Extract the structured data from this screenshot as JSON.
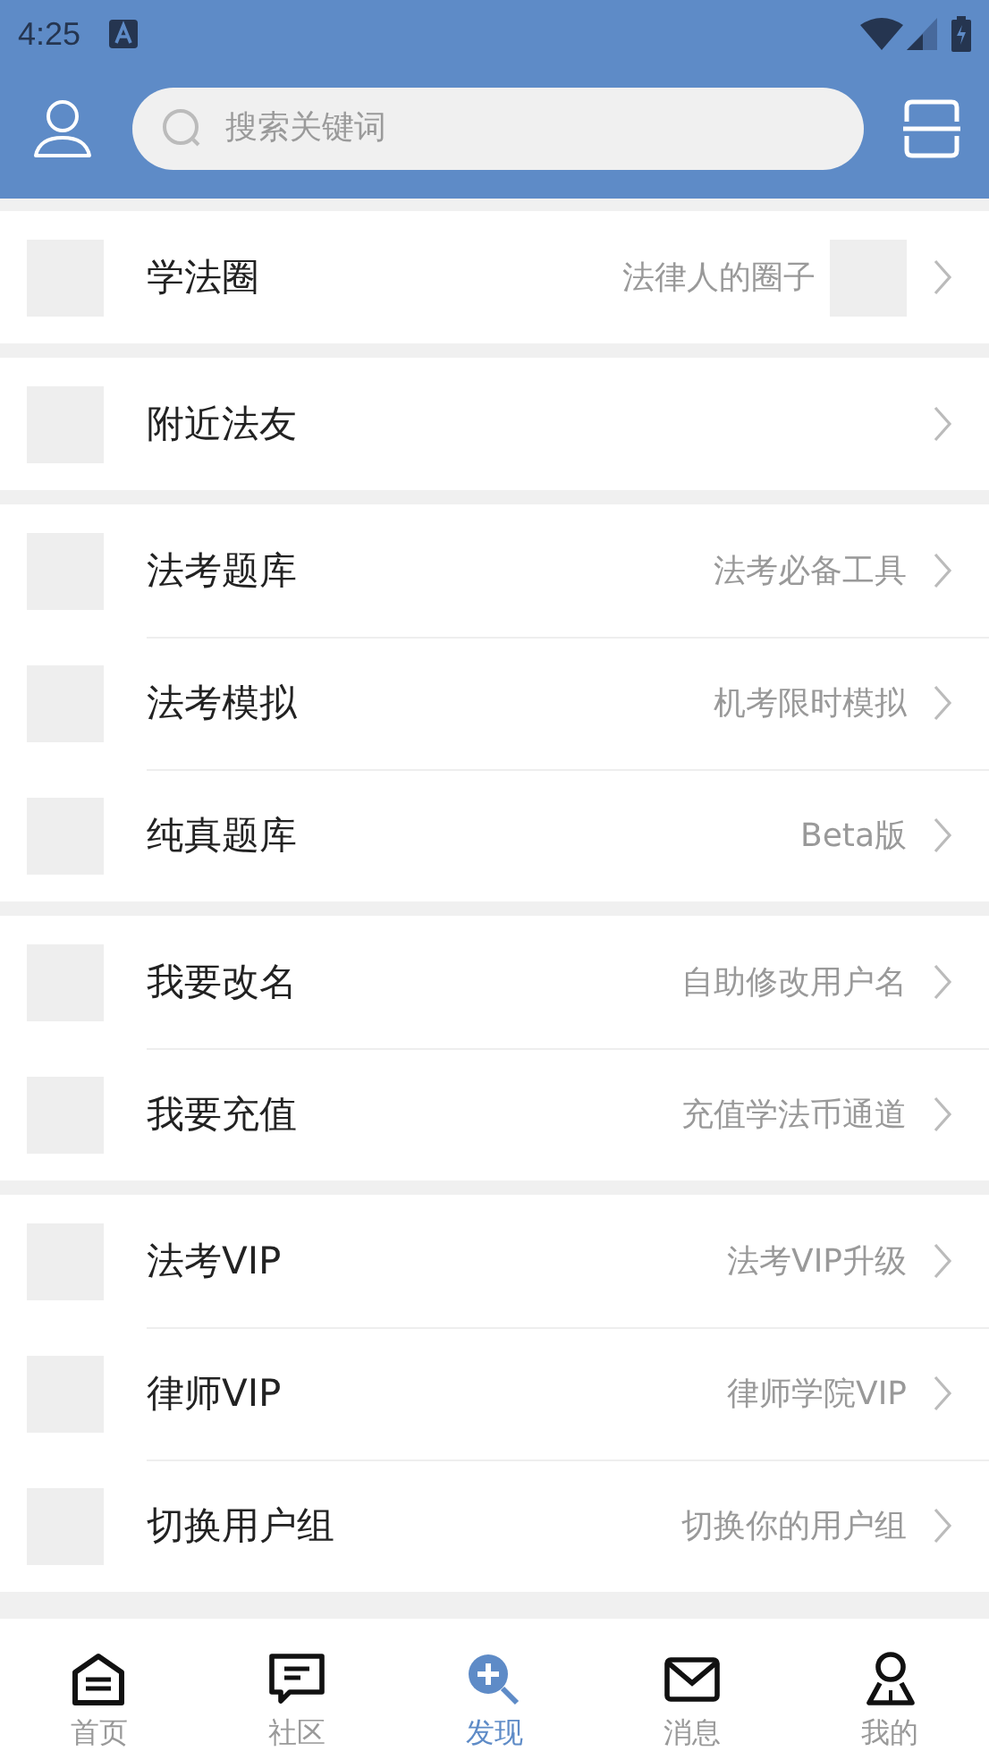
{
  "status_bar": {
    "time": "4:25"
  },
  "header": {
    "search": {
      "placeholder": "搜索关键词"
    }
  },
  "groups": [
    {
      "items": [
        {
          "title": "学法圈",
          "subtitle": "法律人的圈子",
          "thumbnail": true
        }
      ]
    },
    {
      "items": [
        {
          "title": "附近法友"
        }
      ]
    },
    {
      "items": [
        {
          "title": "法考题库",
          "subtitle": "法考必备工具"
        },
        {
          "title": "法考模拟",
          "subtitle": "机考限时模拟"
        },
        {
          "title": "纯真题库",
          "subtitle": "Beta版"
        }
      ]
    },
    {
      "items": [
        {
          "title": "我要改名",
          "subtitle": "自助修改用户名"
        },
        {
          "title": "我要充值",
          "subtitle": "充值学法币通道"
        }
      ]
    },
    {
      "items": [
        {
          "title": "法考VIP",
          "subtitle": "法考VIP升级"
        },
        {
          "title": "律师VIP",
          "subtitle": "律师学院VIP"
        },
        {
          "title": "切换用户组",
          "subtitle": "切换你的用户组"
        }
      ]
    }
  ],
  "tabs": [
    {
      "kind": "home",
      "label": "首页",
      "selected": false
    },
    {
      "kind": "community",
      "label": "社区",
      "selected": false
    },
    {
      "kind": "discover",
      "label": "发现",
      "selected": true
    },
    {
      "kind": "messages",
      "label": "消息",
      "selected": false
    },
    {
      "kind": "profile",
      "label": "我的",
      "selected": false
    }
  ]
}
